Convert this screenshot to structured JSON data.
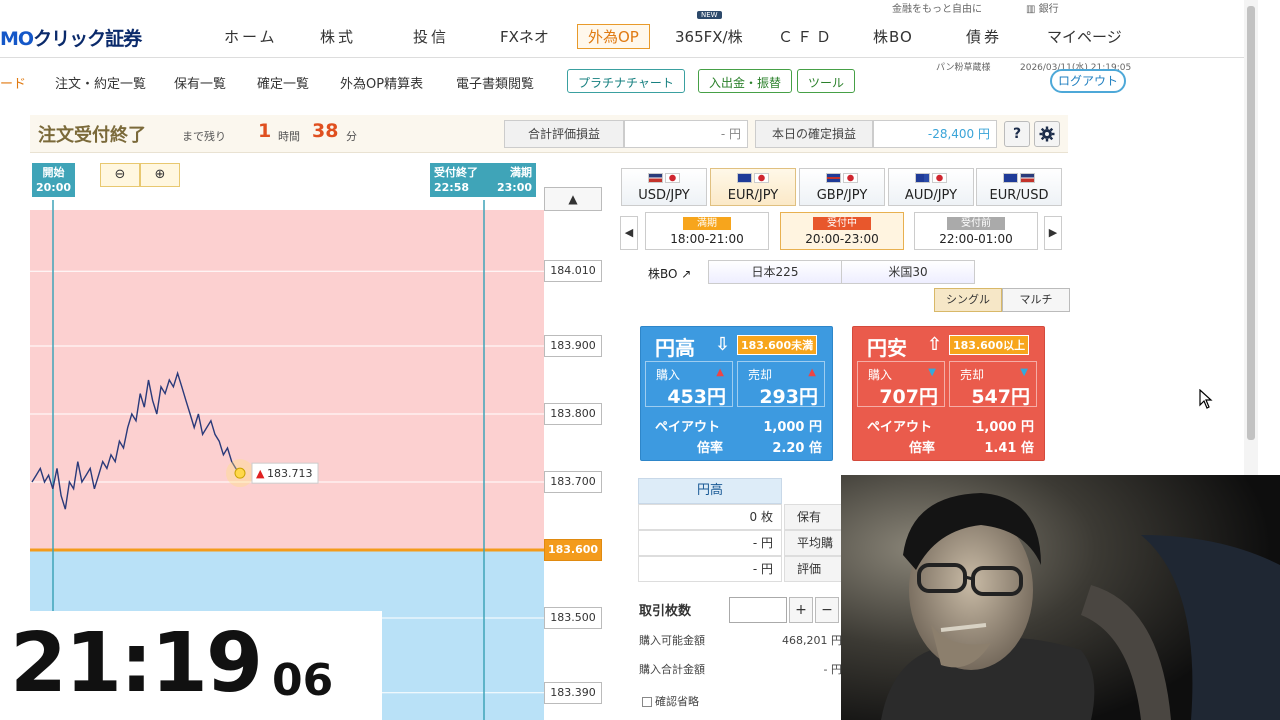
{
  "brand": {
    "logo_prefix": "MO",
    "logo_main": "クリック証券"
  },
  "top_right": {
    "link1": "金融をもっと自由に",
    "link2": "銀行"
  },
  "nav": {
    "items": [
      "ホーム",
      "株式",
      "投信",
      "FXネオ",
      "外為OP",
      "365FX/株",
      "ＣＦＤ",
      "株BO",
      "債券",
      "マイページ"
    ],
    "new_badge": "NEW"
  },
  "subnav": {
    "first_partial": "ード",
    "links": [
      "注文・約定一覧",
      "保有一覧",
      "確定一覧",
      "外為OP精算表",
      "電子書類閲覧"
    ],
    "buttons": [
      "プラチナチャート",
      "入出金・振替",
      "ツール"
    ],
    "user_name": "パン粉草蔵様",
    "datetime": "2026/03/11(水) 21:19:05",
    "logout": "ログアウト"
  },
  "status": {
    "title": "注文受付終了",
    "remain_label": "まで残り",
    "hours": "1",
    "hours_unit": "時間",
    "minutes": "38",
    "minutes_unit": "分",
    "total_pl_label": "合計評価損益",
    "total_pl_value": "- 円",
    "today_pl_label": "本日の確定損益",
    "today_pl_value": "-28,400 円",
    "help_icon": "?",
    "settings_icon": "gear-icon"
  },
  "chart": {
    "start_label": "開始",
    "start_time": "20:00",
    "accept_end_label": "受付終了",
    "accept_end_time": "22:58",
    "expiry_label": "満期",
    "expiry_time": "23:00",
    "zoom_out": "−",
    "zoom_in": "+",
    "current_price": "183.713",
    "strike_price": "183.600",
    "price_ticks": [
      "184.010",
      "183.900",
      "183.800",
      "183.700",
      "183.600",
      "183.500",
      "183.390"
    ],
    "colors": {
      "above": "#fcd0d0",
      "below": "#b9e1f7",
      "strike": "#f39b1c",
      "line": "#2a3a7a"
    }
  },
  "chart_data": {
    "type": "line",
    "ylim": [
      183.35,
      184.1
    ],
    "x": [
      0,
      1,
      2,
      3,
      4,
      5,
      6,
      7,
      8,
      9,
      10,
      11,
      12,
      13,
      14,
      15,
      16,
      17,
      18,
      19,
      20,
      21,
      22,
      23,
      24,
      25,
      26,
      27,
      28,
      29,
      30,
      31,
      32,
      33,
      34,
      35,
      36,
      37,
      38,
      39,
      40,
      41,
      42,
      43,
      44,
      45,
      46,
      47,
      48,
      49,
      50
    ],
    "values": [
      183.7,
      183.71,
      183.72,
      183.7,
      183.71,
      183.69,
      183.72,
      183.68,
      183.66,
      183.7,
      183.69,
      183.73,
      183.7,
      183.71,
      183.72,
      183.69,
      183.71,
      183.73,
      183.72,
      183.74,
      183.73,
      183.76,
      183.75,
      183.78,
      183.8,
      183.79,
      183.83,
      183.81,
      183.85,
      183.82,
      183.8,
      183.84,
      183.83,
      183.85,
      183.84,
      183.86,
      183.84,
      183.82,
      183.8,
      183.78,
      183.8,
      183.77,
      183.78,
      183.79,
      183.77,
      183.76,
      183.74,
      183.75,
      183.73,
      183.72,
      183.713
    ]
  },
  "pairs": [
    {
      "label": "USD/JPY",
      "flags": [
        "us",
        "jp"
      ]
    },
    {
      "label": "EUR/JPY",
      "flags": [
        "eu",
        "jp"
      ]
    },
    {
      "label": "GBP/JPY",
      "flags": [
        "gb",
        "jp"
      ]
    },
    {
      "label": "AUD/JPY",
      "flags": [
        "au",
        "jp"
      ]
    },
    {
      "label": "EUR/USD",
      "flags": [
        "eu",
        "us"
      ]
    }
  ],
  "rounds": [
    {
      "tag": "満期",
      "time": "18:00-21:00",
      "color": "#f7a51c"
    },
    {
      "tag": "受付中",
      "time": "20:00-23:00",
      "color": "#e8572c"
    },
    {
      "tag": "受付前",
      "time": "22:00-01:00",
      "color": "#aaaaaa"
    }
  ],
  "kabubo": {
    "label": "株BO ↗",
    "items": [
      "日本225",
      "米国30"
    ]
  },
  "modes": [
    "シングル",
    "マルチ"
  ],
  "high": {
    "title": "円高",
    "condition": "183.600未満",
    "buy_label": "購入",
    "buy_price": "453円",
    "sell_label": "売却",
    "sell_price": "293円",
    "payout_label": "ペイアウト",
    "payout": "1,000 円",
    "ratio_label": "倍率",
    "ratio": "2.20 倍"
  },
  "low": {
    "title": "円安",
    "condition": "183.600以上",
    "buy_label": "購入",
    "buy_price": "707円",
    "sell_label": "売却",
    "sell_price": "547円",
    "payout_label": "ペイアウト",
    "payout": "1,000 円",
    "ratio_label": "倍率",
    "ratio": "1.41 倍"
  },
  "holdings": {
    "head": "円高",
    "rows": [
      "0 枚",
      "- 円",
      "- 円"
    ],
    "side_labels": [
      "保有",
      "平均購",
      "評価"
    ]
  },
  "order": {
    "lot_label": "取引枚数",
    "plus": "+",
    "minus": "−",
    "avail_label": "購入可能金額",
    "avail_value": "468,201 円",
    "total_label": "購入合計金額",
    "total_value": "- 円",
    "confirm_label": "確認省略"
  },
  "clock": {
    "hm": "21:19",
    "sec": "06"
  }
}
